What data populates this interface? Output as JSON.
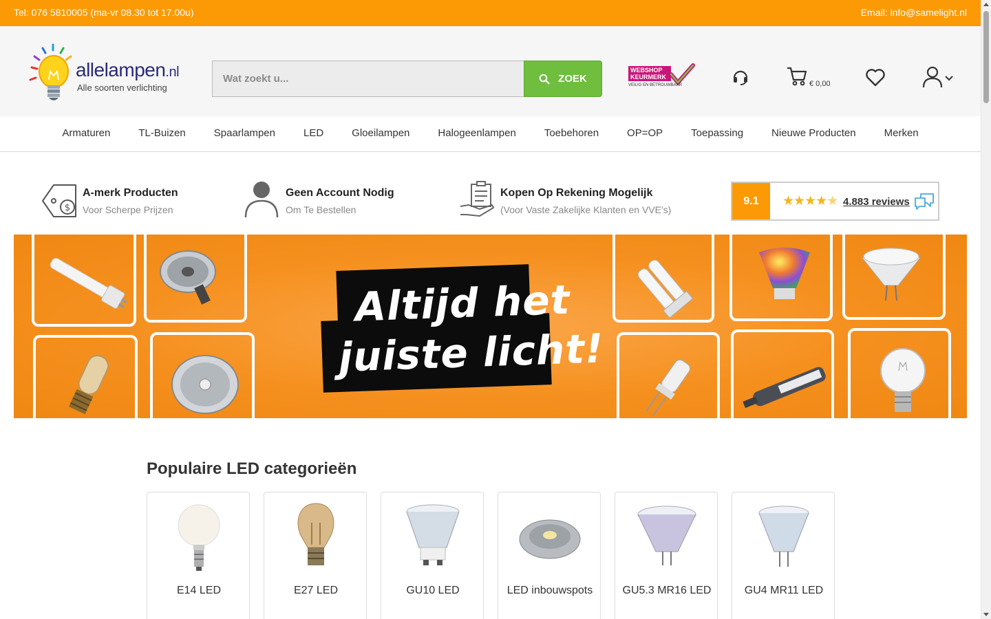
{
  "topbar": {
    "phone": "Tel: 076 5810005 (ma-vr 08.30 tot 17.00u)",
    "email": "Email: info@samelight.nl"
  },
  "header": {
    "logo_brand": "allelampen",
    "logo_tld": ".nl",
    "logo_tagline": "Alle soorten verlichting",
    "search_placeholder": "Wat zoekt u...",
    "search_button": "ZOEK",
    "keurmerk_line1": "WEBSHOP",
    "keurmerk_line2": "KEURMERK",
    "keurmerk_sub": "VEILIG EN BETROUWBAAR",
    "cart_amount": "€ 0,00",
    "icons": [
      "headset-icon",
      "cart-icon",
      "heart-icon",
      "user-icon"
    ]
  },
  "nav": {
    "items": [
      "Armaturen",
      "TL-Buizen",
      "Spaarlampen",
      "LED",
      "Gloeilampen",
      "Halogeenlampen",
      "Toebehoren",
      "OP=OP",
      "Toepassing",
      "Nieuwe Producten",
      "Merken"
    ]
  },
  "usps": [
    {
      "title": "A-merk Producten",
      "sub": "Voor Scherpe Prijzen"
    },
    {
      "title": "Geen Account Nodig",
      "sub": "Om Te Bestellen"
    },
    {
      "title": "Kopen Op Rekening Mogelijk",
      "sub": "(Voor Vaste Zakelijke Klanten en VVE's)"
    }
  ],
  "reviews": {
    "score": "9.1",
    "count_link": "4.883 reviews",
    "stars_value": 4.5
  },
  "banner": {
    "line1": "Altijd het",
    "line2": "juiste licht!"
  },
  "categories": {
    "title": "Populaire LED categorieën",
    "items": [
      "E14 LED",
      "E27 LED",
      "GU10 LED",
      "LED inbouwspots",
      "GU5.3 MR16 LED",
      "GU4 MR11 LED"
    ]
  },
  "colors": {
    "accent_orange": "#fb9a05",
    "search_green": "#6fbe3d",
    "keurmerk_pink": "#c8167a"
  }
}
